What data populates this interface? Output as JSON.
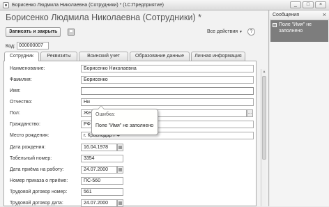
{
  "window": {
    "title": "Борисенко Людмила Николаевна (Сотрудники) * (1С:Предприятие)",
    "controls": [
      "_",
      "□",
      "×"
    ]
  },
  "form": {
    "heading": "Борисенко Людмила Николаевна (Сотрудники) *",
    "save_close_label": "Записать и закрыть",
    "all_actions_label": "Все действия",
    "help_label": "?",
    "code_label": "Код:",
    "code_value": "000000007"
  },
  "tabs": [
    "Сотрудник",
    "Реквизиты",
    "Воинский учет",
    "Образование данные",
    "Личная информация"
  ],
  "fields": {
    "naimenovanie": {
      "label": "Наименование:",
      "value": "Борисенко  Николаевна"
    },
    "familiya": {
      "label": "Фамилия:",
      "value": "Борисенко"
    },
    "imya": {
      "label": "Имя:",
      "value": ""
    },
    "otchestvo": {
      "label": "Отчество:",
      "value": "Ни"
    },
    "pol": {
      "label": "Пол:",
      "value": "Же",
      "button": "..."
    },
    "grazhdanstvo": {
      "label": "Гражданство:",
      "value": "РФ"
    },
    "mesto_rozhdeniya": {
      "label": "Место рождения:",
      "value": "г. Краснодар РФ"
    },
    "data_rozhdeniya": {
      "label": "Дата рождения:",
      "value": "16.04.1978"
    },
    "tabelny_nomer": {
      "label": "Табельный номер:",
      "value": "3354"
    },
    "data_priema": {
      "label": "Дата приёма на работу:",
      "value": "24.07.2000"
    },
    "nomer_prikaza": {
      "label": "Номер приказа о приёме:",
      "value": "ПС-560"
    },
    "trudovoy_nomer": {
      "label": "Трудовой договор номер:",
      "value": "561"
    },
    "trudovoy_data": {
      "label": "Трудовой договор дата:",
      "value": "24.07.2000"
    }
  },
  "tooltip": {
    "title": "Ошибка:",
    "message": "Поле \"Имя\" не заполнено"
  },
  "messages": {
    "title": "Сообщения",
    "close": "×",
    "item": "Поле \"Имя\" не заполнено"
  }
}
